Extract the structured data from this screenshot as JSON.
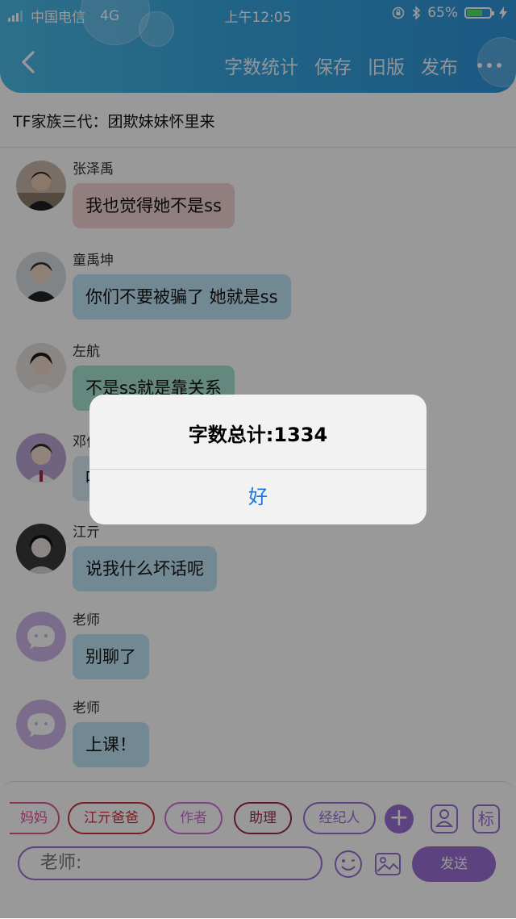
{
  "status_bar": {
    "carrier": "中国电信",
    "network": "4G",
    "time": "上午12:05",
    "battery_percent": "65%",
    "battery_level": 0.65
  },
  "nav": {
    "actions": [
      "字数统计",
      "保存",
      "旧版",
      "发布"
    ]
  },
  "story_title": "TF家族三代：团欺妹妹怀里来",
  "messages": [
    {
      "sender": "张泽禹",
      "text": "我也觉得她不是ss",
      "bubble_color": "#f2d4d6"
    },
    {
      "sender": "童禹坤",
      "text": "你们不要被骗了 她就是ss",
      "bubble_color": "#bfe3f5"
    },
    {
      "sender": "左航",
      "text": "不是ss就是靠关系",
      "bubble_color": "#a8e3d2"
    },
    {
      "sender": "邓佳鑫",
      "text": "哈哈",
      "bubble_color": "#d7e9f5"
    },
    {
      "sender": "江亓",
      "text": "说我什么坏话呢",
      "bubble_color": "#bfe3f5"
    },
    {
      "sender": "老师",
      "text": "别聊了",
      "bubble_color": "#bfe3f5"
    },
    {
      "sender": "老师",
      "text": "上课！",
      "bubble_color": "#bfe3f5"
    }
  ],
  "role_chips": [
    {
      "label": "妈妈",
      "color": "#e0559a"
    },
    {
      "label": "江亓爸爸",
      "color": "#c8323e"
    },
    {
      "label": "作者",
      "color": "#d06fd4"
    },
    {
      "label": "助理",
      "color": "#a0254a"
    },
    {
      "label": "经纪人",
      "color": "#9b6fd6"
    }
  ],
  "tag_button_label": "标",
  "input": {
    "value": "老师:"
  },
  "send_label": "发送",
  "alert": {
    "title": "字数总计:1334",
    "button": "好"
  },
  "colors": {
    "accent_purple": "#9b6fd6",
    "header_blue": "#38a6e0",
    "alert_button_blue": "#1677e6"
  }
}
